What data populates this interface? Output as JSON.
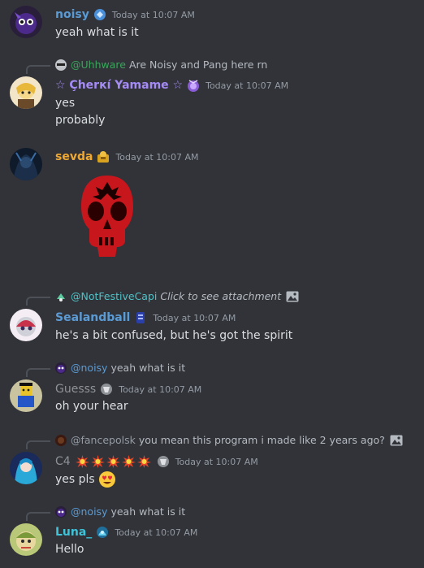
{
  "messages": [
    {
      "username": "noisy",
      "timestamp": "Today at 10:07 AM",
      "lines": [
        "yeah what is it"
      ],
      "name_color": "#5b9bd5"
    },
    {
      "reply": {
        "mention": "@Uhhware",
        "text": "Are Noisy and Pang here rn"
      },
      "username": "☆ Çherкí Yamame ☆",
      "timestamp": "Today at 10:07 AM",
      "lines": [
        "yes",
        "probably"
      ],
      "name_color": "#a58bf5"
    },
    {
      "username": "sevda",
      "timestamp": "Today at 10:07 AM",
      "lines": [],
      "name_color": "#f0a830",
      "attachment": "skull-flag-image"
    },
    {
      "reply": {
        "mention": "@NotFestiveCapi",
        "text": "Click to see attachment"
      },
      "username": "Sealandball",
      "timestamp": "Today at 10:07 AM",
      "lines": [
        "he's a bit confused, but he's got the spirit"
      ],
      "name_color": "#5b9bd5"
    },
    {
      "reply": {
        "mention": "@noisy",
        "text": "yeah what is it"
      },
      "username": "Guesss",
      "timestamp": "Today at 10:07 AM",
      "lines": [
        "oh your hear"
      ],
      "name_color": "#8e9297"
    },
    {
      "reply": {
        "mention": "@fancepolsk",
        "text": "you mean this program i made like 2 years ago?"
      },
      "username": "C4",
      "timestamp": "Today at 10:07 AM",
      "lines": [
        "yes pls"
      ],
      "name_color": "#8e9297"
    },
    {
      "reply": {
        "mention": "@noisy",
        "text": "yeah what is it"
      },
      "username": "Luna_",
      "timestamp": "Today at 10:07 AM",
      "lines": [
        "Hello"
      ],
      "name_color": "#3ec3d9"
    }
  ]
}
